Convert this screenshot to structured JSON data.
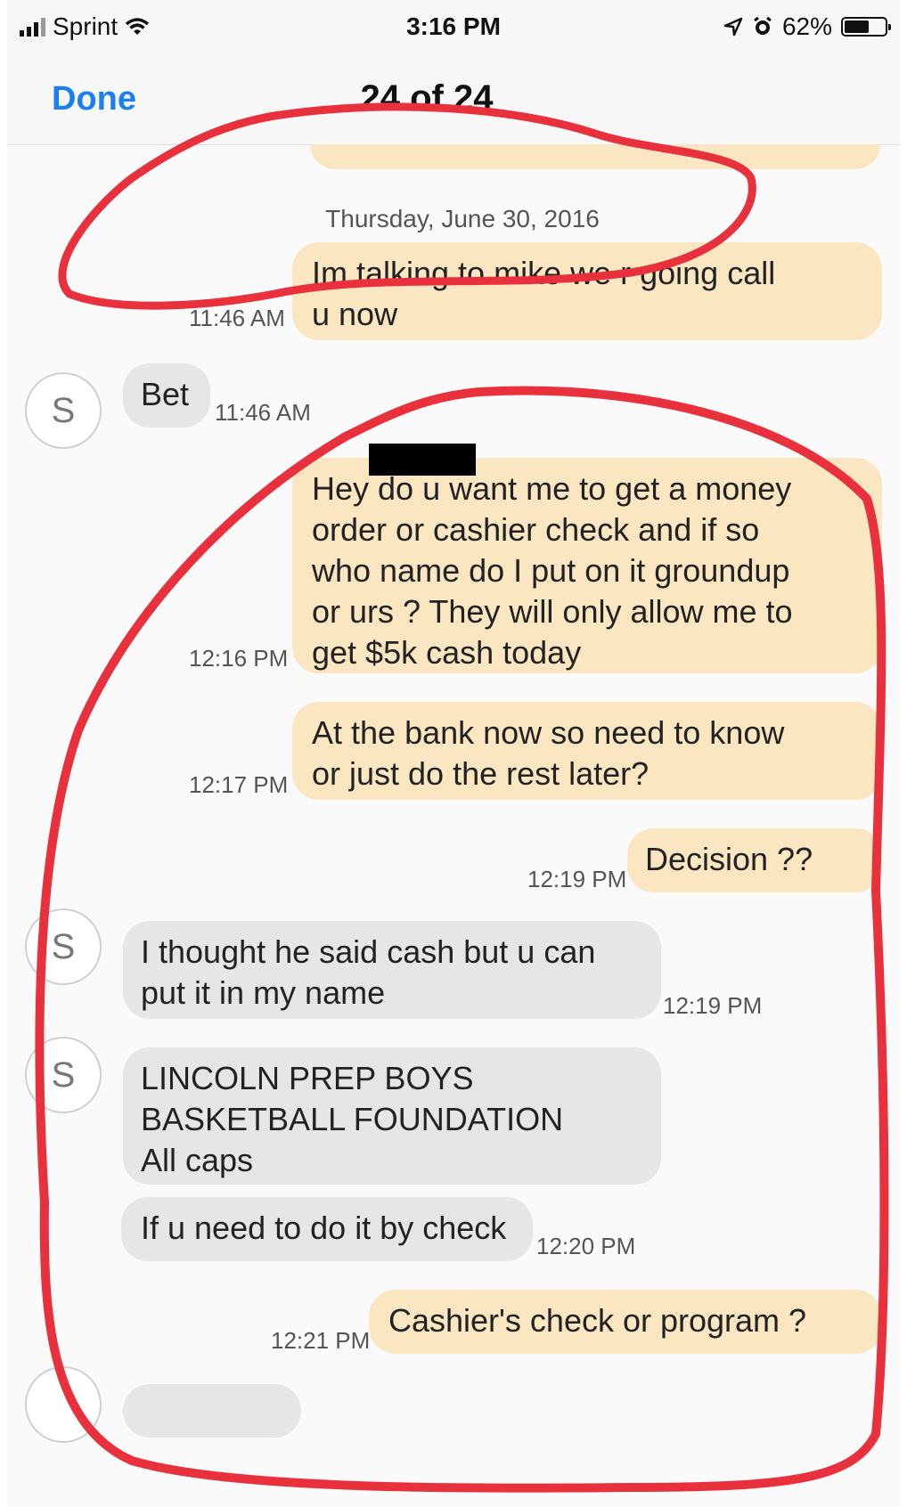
{
  "status_bar": {
    "carrier": "Sprint",
    "time": "3:16 PM",
    "battery_percent": "62%",
    "battery_level": 0.62,
    "icons": [
      "signal-icon",
      "wifi-icon",
      "location-icon",
      "alarm-icon",
      "battery-icon"
    ]
  },
  "nav": {
    "done_label": "Done",
    "title": "24 of 24"
  },
  "thread": {
    "date_header": "Thursday, June 30, 2016",
    "messages": [
      {
        "dir": "out",
        "text_lines": [
          "Im talking to mike we r going call",
          "u now"
        ],
        "time": "11:46 AM"
      },
      {
        "dir": "in",
        "avatar": "S",
        "text": "Bet",
        "time": "11:46 AM"
      },
      {
        "dir": "out",
        "text_lines": [
          "Hey do u want me to get a money",
          "order or cashier check and if so",
          "who name do I put on it groundup",
          "or urs ? They will only allow me to",
          "get $5k cash today"
        ],
        "time": "12:16 PM"
      },
      {
        "dir": "out",
        "text_lines": [
          "At the bank now so need to know",
          "or just do the rest later?"
        ],
        "time": "12:17 PM"
      },
      {
        "dir": "out",
        "text": "Decision ??",
        "time": "12:19 PM"
      },
      {
        "dir": "in",
        "avatar": "S",
        "text_lines": [
          "I thought he said cash but u can",
          "put it in my name"
        ],
        "time": "12:19 PM"
      },
      {
        "dir": "in",
        "avatar": "S",
        "text_lines": [
          "LINCOLN PREP BOYS",
          "BASKETBALL FOUNDATION",
          "All caps"
        ]
      },
      {
        "dir": "in",
        "text": "If u need to do it by check",
        "time": "12:20 PM"
      },
      {
        "dir": "out",
        "text": "Cashier's check or program ?",
        "time": "12:21 PM"
      }
    ]
  },
  "colors": {
    "outgoing_bubble": "#fbe6c2",
    "incoming_bubble": "#e6e6e6",
    "accent": "#1a7ff0",
    "annotation_red": "#e8313c"
  }
}
